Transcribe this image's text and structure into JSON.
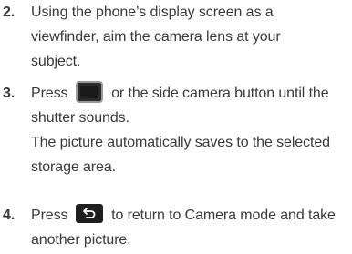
{
  "steps": [
    {
      "number": "2.",
      "lines": [
        "Using the phone’s display screen as a",
        "viewfinder, aim the camera lens at your",
        "subject."
      ]
    },
    {
      "number": "3.",
      "line1_before": "Press",
      "line1_after": "or the side camera button until the",
      "icon": "shutter-key-icon",
      "lines": [
        "shutter sounds.",
        "The picture automatically saves to the selected",
        "storage area."
      ]
    },
    {
      "number": "4.",
      "line1_before": "Press",
      "line1_after": "to return to Camera mode and take",
      "icon": "back-arrow-key-icon",
      "lines": [
        "another picture."
      ]
    }
  ]
}
